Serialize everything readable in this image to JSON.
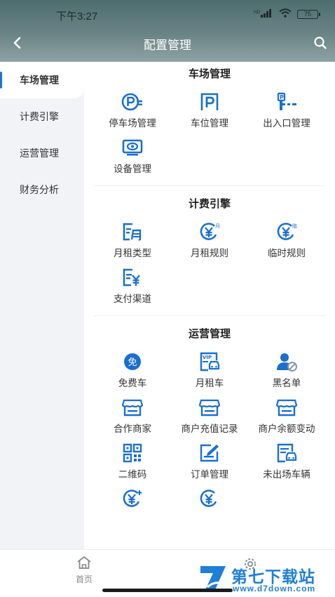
{
  "status_bar": {
    "time": "下午3:27",
    "network": "HD",
    "battery": "75"
  },
  "nav": {
    "title": "配置管理"
  },
  "sidebar": {
    "items": [
      {
        "label": "车场管理",
        "active": true
      },
      {
        "label": "计费引擎"
      },
      {
        "label": "运营管理"
      },
      {
        "label": "财务分析"
      }
    ]
  },
  "sections": {
    "parking": {
      "title": "车场管理",
      "items": [
        {
          "label": "停车场管理",
          "icon": "parking-lot-icon"
        },
        {
          "label": "车位管理",
          "icon": "parking-space-icon"
        },
        {
          "label": "出入口管理",
          "icon": "barrier-gate-icon"
        },
        {
          "label": "设备管理",
          "icon": "device-icon"
        }
      ]
    },
    "billing": {
      "title": "计费引擎",
      "items": [
        {
          "label": "月租类型",
          "icon": "monthly-type-icon"
        },
        {
          "label": "月租规则",
          "icon": "monthly-rule-icon",
          "badge": "月"
        },
        {
          "label": "临时规则",
          "icon": "temporary-rule-icon",
          "badge": "临"
        },
        {
          "label": "支付渠道",
          "icon": "payment-channel-icon"
        }
      ]
    },
    "operations": {
      "title": "运营管理",
      "items": [
        {
          "label": "免费车",
          "icon": "free-car-icon",
          "badge": "免"
        },
        {
          "label": "月租车",
          "icon": "monthly-car-icon",
          "badge": "VIP"
        },
        {
          "label": "黑名单",
          "icon": "blacklist-icon"
        },
        {
          "label": "合作商家",
          "icon": "merchant-icon"
        },
        {
          "label": "商户充值记录",
          "icon": "merchant-recharge-icon"
        },
        {
          "label": "商户余额变动",
          "icon": "merchant-balance-icon"
        },
        {
          "label": "二维码",
          "icon": "qr-code-icon"
        },
        {
          "label": "订单管理",
          "icon": "order-icon"
        },
        {
          "label": "未出场车辆",
          "icon": "car-not-exited-icon"
        }
      ]
    }
  },
  "tabbar": {
    "home_label": "首页"
  },
  "watermark": {
    "text": "第七下载站",
    "url": "www.d7down.com"
  },
  "colors": {
    "accent": "#1a73d9",
    "header_top": "#4d6d6f",
    "sidebar_bg": "#f2f3f7",
    "icon_blue": "#1a6fd0"
  }
}
